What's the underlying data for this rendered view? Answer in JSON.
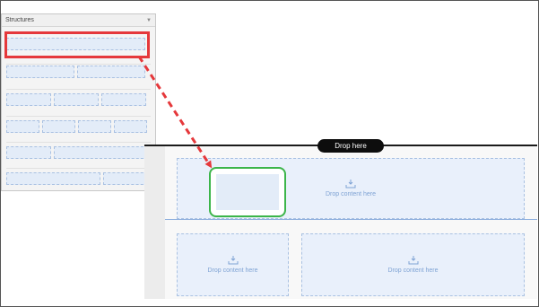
{
  "structures_panel": {
    "title": "Structures",
    "collapse_icon": "chevron-down-icon"
  },
  "canvas": {
    "drop_indicator_label": "Drop here",
    "zones": [
      {
        "label": "Drop content here",
        "icon": "download-tray-icon"
      },
      {
        "label": "Drop content here",
        "icon": "download-tray-icon"
      },
      {
        "label": "Drop content here",
        "icon": "download-tray-icon"
      }
    ]
  },
  "colors": {
    "highlight": "#e5383b",
    "drag_arrow": "#e5383b",
    "ghost_border": "#3cb54a",
    "drop_zone_fill": "#e9f0fb",
    "drop_zone_text": "#7fa3d4"
  }
}
